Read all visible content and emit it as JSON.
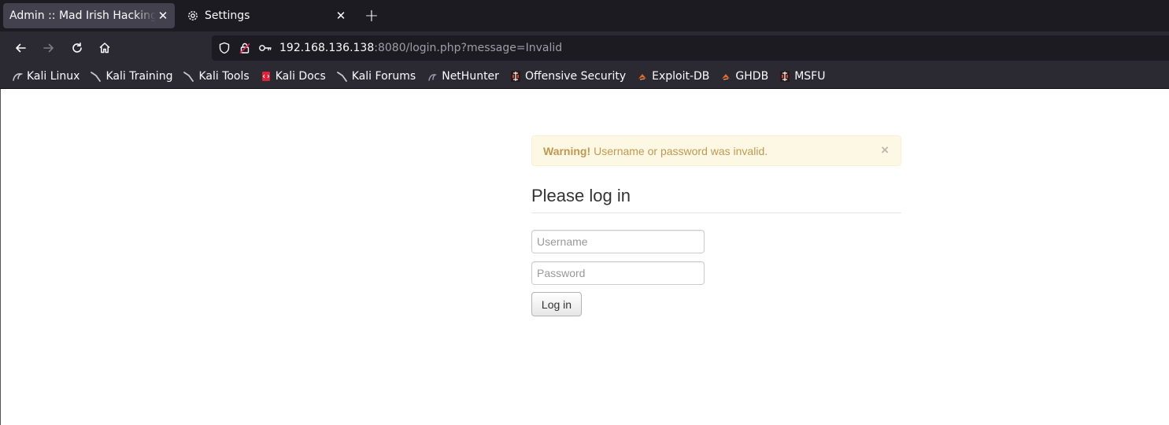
{
  "browser": {
    "tabs": [
      {
        "title": "Admin :: Mad Irish Hacking Academy",
        "active": true
      },
      {
        "title": "Settings",
        "active": false
      }
    ],
    "url": {
      "host": "192.168.136.138",
      "rest": ":8080/login.php?message=Invalid"
    },
    "bookmarks": [
      {
        "label": "Kali Linux",
        "icon": "kali-dragon-icon"
      },
      {
        "label": "Kali Training",
        "icon": "kali-dragon-icon"
      },
      {
        "label": "Kali Tools",
        "icon": "kali-dragon-icon"
      },
      {
        "label": "Kali Docs",
        "icon": "kali-docs-icon"
      },
      {
        "label": "Kali Forums",
        "icon": "kali-dragon-icon"
      },
      {
        "label": "NetHunter",
        "icon": "nethunter-icon"
      },
      {
        "label": "Offensive Security",
        "icon": "offsec-icon"
      },
      {
        "label": "Exploit-DB",
        "icon": "exploitdb-icon"
      },
      {
        "label": "GHDB",
        "icon": "exploitdb-icon"
      },
      {
        "label": "MSFU",
        "icon": "offsec-icon"
      }
    ]
  },
  "page": {
    "alert": {
      "strong": "Warning!",
      "message": "Username or password was invalid.",
      "close": "×"
    },
    "heading": "Please log in",
    "username_placeholder": "Username",
    "password_placeholder": "Password",
    "login_label": "Log in"
  },
  "colors": {
    "alert_bg": "#fcf8e3",
    "alert_text": "#c09853",
    "chrome_dark": "#1c1b22",
    "chrome_toolbar": "#2b2a33"
  }
}
